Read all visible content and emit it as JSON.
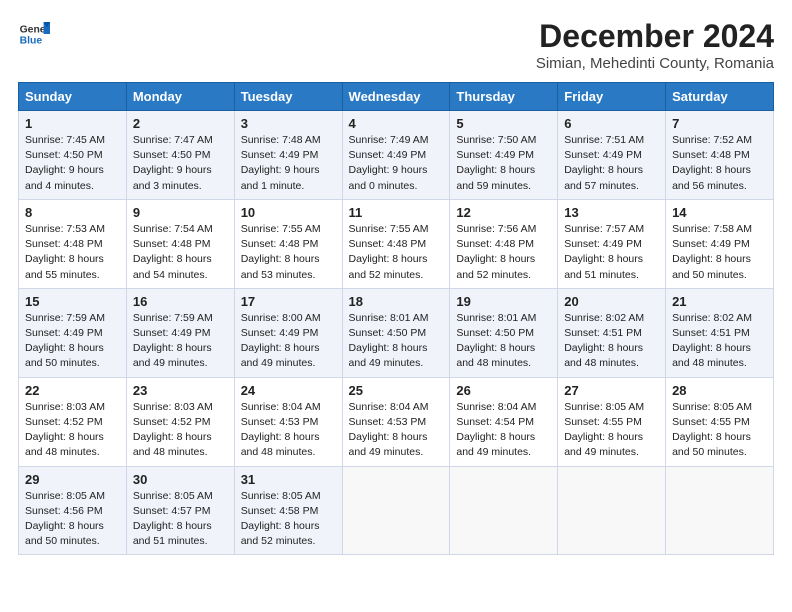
{
  "logo": {
    "line1": "General",
    "line2": "Blue"
  },
  "title": "December 2024",
  "subtitle": "Simian, Mehedinti County, Romania",
  "weekdays": [
    "Sunday",
    "Monday",
    "Tuesday",
    "Wednesday",
    "Thursday",
    "Friday",
    "Saturday"
  ],
  "weeks": [
    [
      {
        "day": "1",
        "sunrise": "7:45 AM",
        "sunset": "4:50 PM",
        "daylight": "9 hours and 4 minutes."
      },
      {
        "day": "2",
        "sunrise": "7:47 AM",
        "sunset": "4:50 PM",
        "daylight": "9 hours and 3 minutes."
      },
      {
        "day": "3",
        "sunrise": "7:48 AM",
        "sunset": "4:49 PM",
        "daylight": "9 hours and 1 minute."
      },
      {
        "day": "4",
        "sunrise": "7:49 AM",
        "sunset": "4:49 PM",
        "daylight": "9 hours and 0 minutes."
      },
      {
        "day": "5",
        "sunrise": "7:50 AM",
        "sunset": "4:49 PM",
        "daylight": "8 hours and 59 minutes."
      },
      {
        "day": "6",
        "sunrise": "7:51 AM",
        "sunset": "4:49 PM",
        "daylight": "8 hours and 57 minutes."
      },
      {
        "day": "7",
        "sunrise": "7:52 AM",
        "sunset": "4:48 PM",
        "daylight": "8 hours and 56 minutes."
      }
    ],
    [
      {
        "day": "8",
        "sunrise": "7:53 AM",
        "sunset": "4:48 PM",
        "daylight": "8 hours and 55 minutes."
      },
      {
        "day": "9",
        "sunrise": "7:54 AM",
        "sunset": "4:48 PM",
        "daylight": "8 hours and 54 minutes."
      },
      {
        "day": "10",
        "sunrise": "7:55 AM",
        "sunset": "4:48 PM",
        "daylight": "8 hours and 53 minutes."
      },
      {
        "day": "11",
        "sunrise": "7:55 AM",
        "sunset": "4:48 PM",
        "daylight": "8 hours and 52 minutes."
      },
      {
        "day": "12",
        "sunrise": "7:56 AM",
        "sunset": "4:48 PM",
        "daylight": "8 hours and 52 minutes."
      },
      {
        "day": "13",
        "sunrise": "7:57 AM",
        "sunset": "4:49 PM",
        "daylight": "8 hours and 51 minutes."
      },
      {
        "day": "14",
        "sunrise": "7:58 AM",
        "sunset": "4:49 PM",
        "daylight": "8 hours and 50 minutes."
      }
    ],
    [
      {
        "day": "15",
        "sunrise": "7:59 AM",
        "sunset": "4:49 PM",
        "daylight": "8 hours and 50 minutes."
      },
      {
        "day": "16",
        "sunrise": "7:59 AM",
        "sunset": "4:49 PM",
        "daylight": "8 hours and 49 minutes."
      },
      {
        "day": "17",
        "sunrise": "8:00 AM",
        "sunset": "4:49 PM",
        "daylight": "8 hours and 49 minutes."
      },
      {
        "day": "18",
        "sunrise": "8:01 AM",
        "sunset": "4:50 PM",
        "daylight": "8 hours and 49 minutes."
      },
      {
        "day": "19",
        "sunrise": "8:01 AM",
        "sunset": "4:50 PM",
        "daylight": "8 hours and 48 minutes."
      },
      {
        "day": "20",
        "sunrise": "8:02 AM",
        "sunset": "4:51 PM",
        "daylight": "8 hours and 48 minutes."
      },
      {
        "day": "21",
        "sunrise": "8:02 AM",
        "sunset": "4:51 PM",
        "daylight": "8 hours and 48 minutes."
      }
    ],
    [
      {
        "day": "22",
        "sunrise": "8:03 AM",
        "sunset": "4:52 PM",
        "daylight": "8 hours and 48 minutes."
      },
      {
        "day": "23",
        "sunrise": "8:03 AM",
        "sunset": "4:52 PM",
        "daylight": "8 hours and 48 minutes."
      },
      {
        "day": "24",
        "sunrise": "8:04 AM",
        "sunset": "4:53 PM",
        "daylight": "8 hours and 48 minutes."
      },
      {
        "day": "25",
        "sunrise": "8:04 AM",
        "sunset": "4:53 PM",
        "daylight": "8 hours and 49 minutes."
      },
      {
        "day": "26",
        "sunrise": "8:04 AM",
        "sunset": "4:54 PM",
        "daylight": "8 hours and 49 minutes."
      },
      {
        "day": "27",
        "sunrise": "8:05 AM",
        "sunset": "4:55 PM",
        "daylight": "8 hours and 49 minutes."
      },
      {
        "day": "28",
        "sunrise": "8:05 AM",
        "sunset": "4:55 PM",
        "daylight": "8 hours and 50 minutes."
      }
    ],
    [
      {
        "day": "29",
        "sunrise": "8:05 AM",
        "sunset": "4:56 PM",
        "daylight": "8 hours and 50 minutes."
      },
      {
        "day": "30",
        "sunrise": "8:05 AM",
        "sunset": "4:57 PM",
        "daylight": "8 hours and 51 minutes."
      },
      {
        "day": "31",
        "sunrise": "8:05 AM",
        "sunset": "4:58 PM",
        "daylight": "8 hours and 52 minutes."
      },
      null,
      null,
      null,
      null
    ]
  ]
}
